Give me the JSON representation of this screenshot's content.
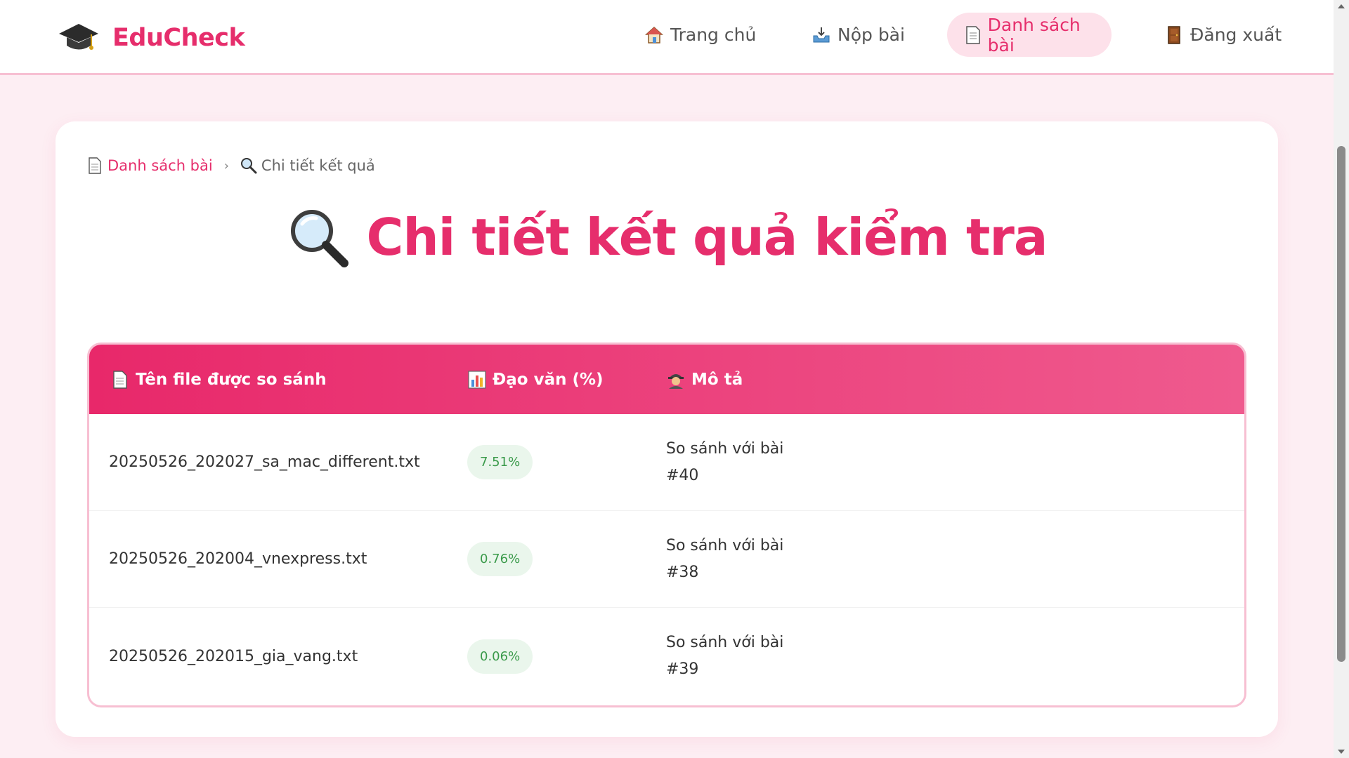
{
  "brand": {
    "name": "EduCheck",
    "icon": "graduation-cap-icon"
  },
  "nav": {
    "home": {
      "label": "Trang chủ",
      "icon": "house-icon"
    },
    "submit": {
      "label": "Nộp bài",
      "icon": "inbox-tray-icon"
    },
    "list": {
      "label": "Danh sách bài",
      "icon": "page-icon",
      "active": true
    },
    "logout": {
      "label": "Đăng xuất",
      "icon": "door-icon"
    }
  },
  "breadcrumb": {
    "parent": "Danh sách bài",
    "separator": "›",
    "current": "Chi tiết kết quả"
  },
  "page_title": "Chi tiết kết quả kiểm tra",
  "table": {
    "headers": {
      "file": "Tên file được so sánh",
      "plagiarism": "Đạo văn (%)",
      "description": "Mô tả"
    },
    "rows": [
      {
        "file": "20250526_202027_sa_mac_different.txt",
        "percent": "7.51%",
        "description": "So sánh với bài #40"
      },
      {
        "file": "20250526_202004_vnexpress.txt",
        "percent": "0.76%",
        "description": "So sánh với bài #38"
      },
      {
        "file": "20250526_202015_gia_vang.txt",
        "percent": "0.06%",
        "description": "So sánh với bài #39"
      }
    ]
  },
  "colors": {
    "accent": "#e62e6c",
    "badge_bg": "#eaf6ec",
    "badge_text": "#3a9a4a",
    "page_bg": "#fdeef3"
  }
}
